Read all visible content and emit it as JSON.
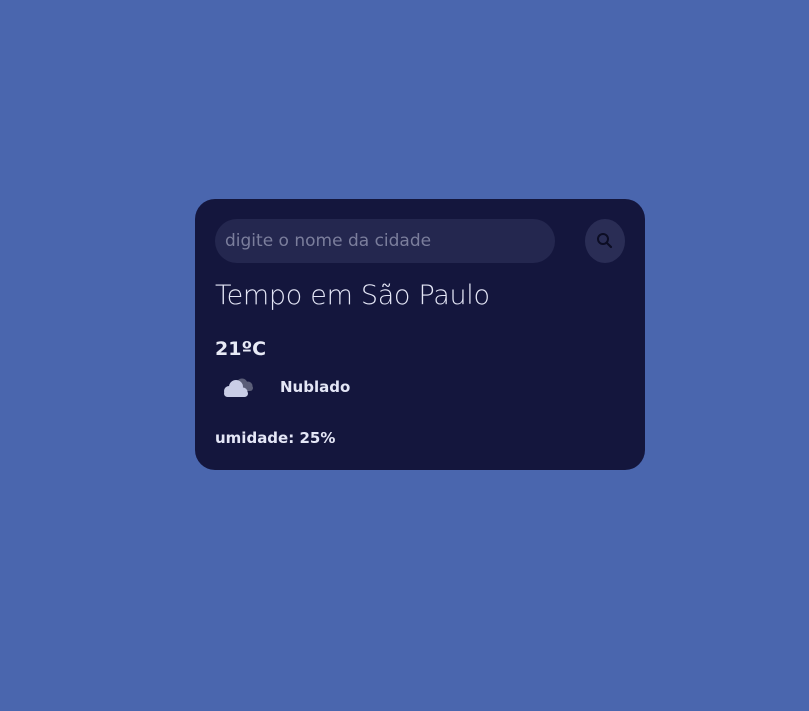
{
  "search": {
    "placeholder": "digite o nome da cidade",
    "value": ""
  },
  "weather": {
    "title": "Tempo em São Paulo",
    "temperature": "21ºC",
    "condition": "Nublado",
    "condition_icon": "cloudy-icon",
    "humidity": "umidade: 25%"
  },
  "colors": {
    "background": "#4a66ae",
    "card": "#14163d",
    "input": "#24274f",
    "button": "#2a2d55",
    "text": "#e4e6f6"
  }
}
